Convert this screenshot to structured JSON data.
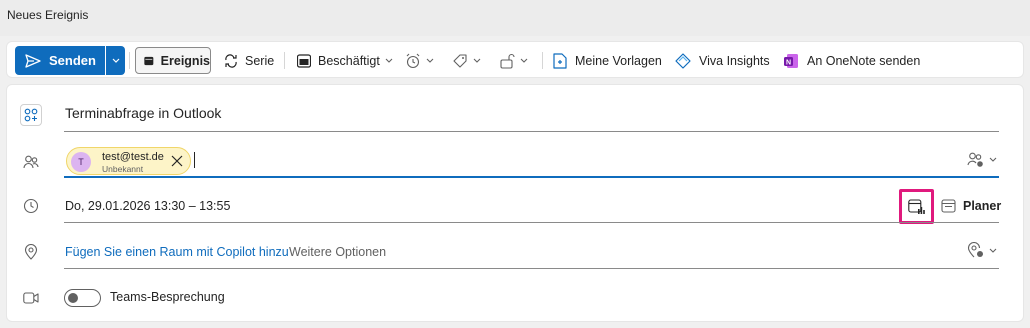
{
  "window": {
    "title": "Neues Ereignis"
  },
  "toolbar": {
    "send_label": "Senden",
    "event_label": "Ereignis",
    "series_label": "Serie",
    "busy_label": "Beschäftigt",
    "templates_label": "Meine Vorlagen",
    "viva_label": "Viva Insights",
    "onenote_label": "An OneNote senden"
  },
  "form": {
    "subject": "Terminabfrage in Outlook",
    "attendees": [
      {
        "initial": "T",
        "email": "test@test.de",
        "status": "Unbekannt"
      }
    ],
    "datetime": "Do, 29.01.2026 13:30 – 13:55",
    "planner_label": "Planer",
    "location_link": "Fügen Sie einen Raum mit Copilot hinzu",
    "location_more": "Weitere Optionen",
    "teams_label": "Teams-Besprechung",
    "teams_enabled": false
  },
  "colors": {
    "accent": "#0f6cbd",
    "chip_bg": "#fdf4c8",
    "avatar_bg": "#dcb4f0",
    "highlight_box": "#e0197d",
    "onenote": "#7719aa"
  }
}
